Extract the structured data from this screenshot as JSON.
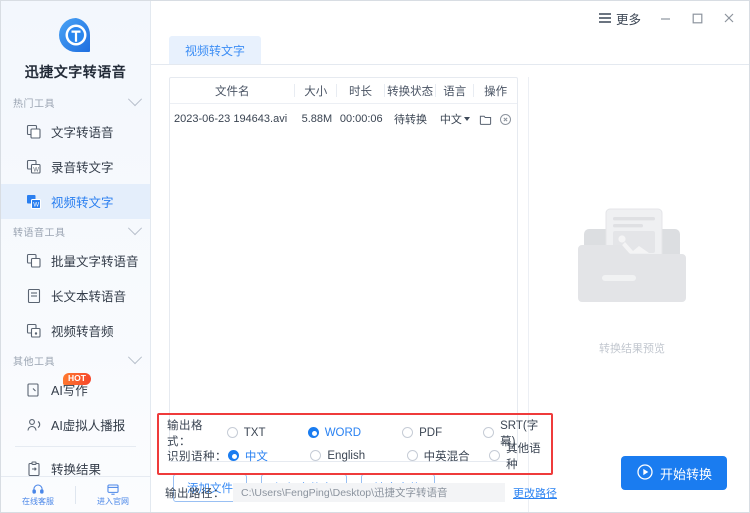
{
  "app": {
    "brand_title": "迅捷文字转语音"
  },
  "titlebar": {
    "more_label": "更多",
    "minimize_label": "—",
    "maximize_label": "□",
    "close_label": "✕"
  },
  "sidebar": {
    "groups": [
      {
        "label": "热门工具",
        "items": [
          {
            "label": "文字转语音",
            "icon": "text-to-speech-icon",
            "active": false
          },
          {
            "label": "录音转文字",
            "icon": "audio-to-text-icon",
            "active": false
          },
          {
            "label": "视频转文字",
            "icon": "video-to-text-icon",
            "active": true
          }
        ]
      },
      {
        "label": "转语音工具",
        "items": [
          {
            "label": "批量文字转语音",
            "icon": "batch-text-to-speech-icon",
            "active": false
          },
          {
            "label": "长文本转语音",
            "icon": "long-text-to-speech-icon",
            "active": false
          },
          {
            "label": "视频转音频",
            "icon": "video-to-audio-icon",
            "active": false
          }
        ]
      },
      {
        "label": "其他工具",
        "items": [
          {
            "label": "AI写作",
            "icon": "ai-writing-icon",
            "active": false,
            "badge": "HOT"
          },
          {
            "label": "AI虚拟人播报",
            "icon": "ai-avatar-icon",
            "active": false
          }
        ]
      }
    ],
    "result_item": {
      "label": "转换结果",
      "icon": "clipboard-icon"
    },
    "footer": [
      {
        "label": "在线客服",
        "icon": "headset-icon"
      },
      {
        "label": "进入官网",
        "icon": "monitor-icon"
      }
    ]
  },
  "tabs": [
    {
      "label": "视频转文字",
      "active": true
    }
  ],
  "table": {
    "columns": [
      "文件名",
      "大小",
      "时长",
      "转换状态",
      "语言",
      "操作"
    ],
    "rows": [
      {
        "name": "2023-06-23 194643.avi",
        "size": "5.88M",
        "duration": "00:00:06",
        "status": "待转换",
        "language": "中文",
        "ops": [
          "folder-icon",
          "remove-icon"
        ]
      }
    ]
  },
  "file_buttons": [
    "添加文件",
    "添加文件夹",
    "清空文件"
  ],
  "preview": {
    "label": "转换结果预览"
  },
  "options": {
    "format": {
      "label": "输出格式：",
      "choices": [
        {
          "label": "TXT",
          "selected": false
        },
        {
          "label": "WORD",
          "selected": true
        },
        {
          "label": "PDF",
          "selected": false
        },
        {
          "label": "SRT(字幕)",
          "selected": false
        }
      ]
    },
    "language": {
      "label": "识别语种：",
      "choices": [
        {
          "label": "中文",
          "selected": true
        },
        {
          "label": "English",
          "selected": false
        },
        {
          "label": "中英混合",
          "selected": false
        },
        {
          "label": "其他语种",
          "selected": false
        }
      ]
    },
    "highlight_color": "#ef3b3b"
  },
  "output_path": {
    "label": "输出路径：",
    "value": "C:\\Users\\FengPing\\Desktop\\迅捷文字转语音",
    "change_link": "更改路径"
  },
  "start_button": {
    "label": "开始转换",
    "icon": "play-circle-icon",
    "color": "#1a7cf0"
  }
}
